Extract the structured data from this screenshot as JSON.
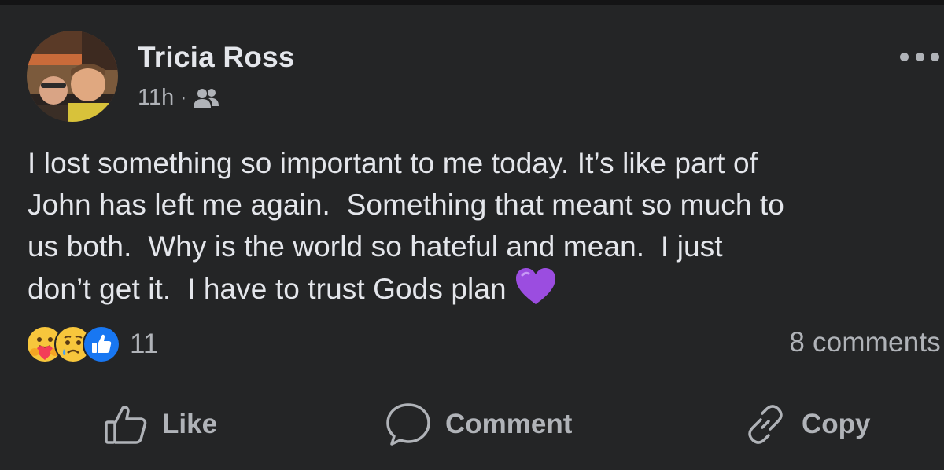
{
  "post": {
    "author": "Tricia Ross",
    "time": "11h",
    "separator": "·",
    "audience_icon": "friends-icon",
    "text": "I lost something so important to me today. It’s like part of\nJohn has left me again.  Something that meant so much to\nus both.  Why is the world so hateful and mean.  I just\ndon’t get it.  I have to trust Gods plan ",
    "emoji": "💜",
    "reactions": {
      "types": [
        "care",
        "sad",
        "like"
      ],
      "count": "11"
    },
    "comments_label": "8 comments"
  },
  "actions": {
    "like": "Like",
    "comment": "Comment",
    "copy": "Copy"
  },
  "colors": {
    "background": "#242526",
    "text": "#e4e6eb",
    "secondary": "#b0b3b8",
    "like_blue": "#1877f2",
    "emoji_yellow": "#f7c63c",
    "heart_purple": "#9b4de0"
  }
}
